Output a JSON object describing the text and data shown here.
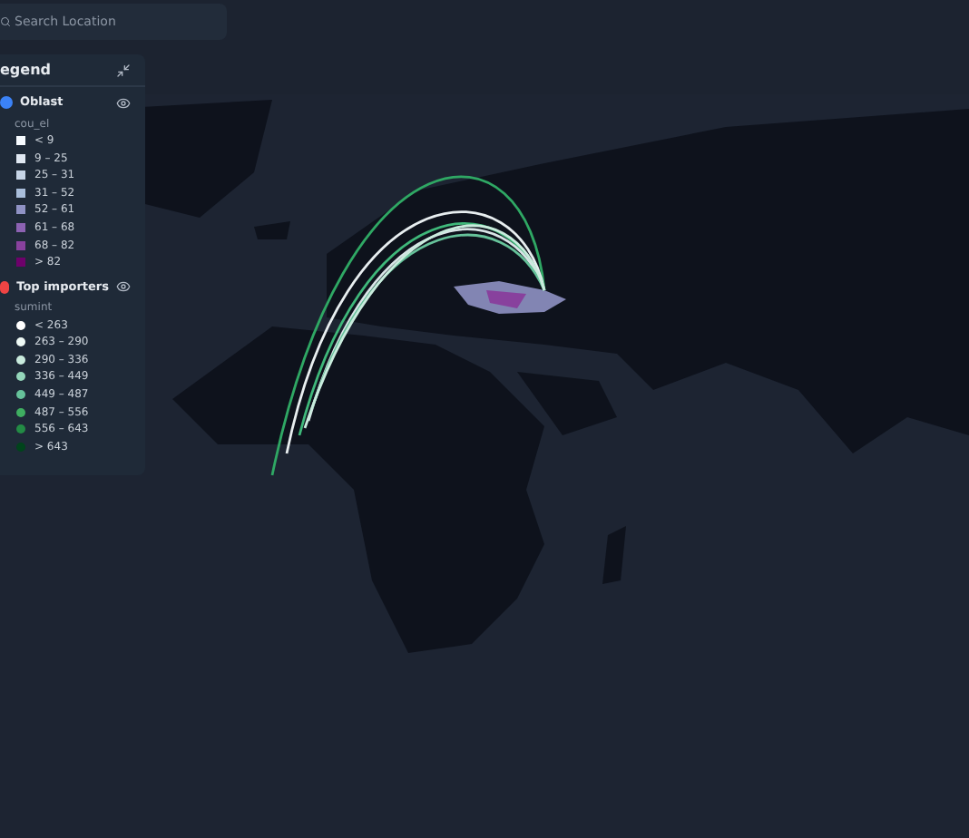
{
  "search": {
    "placeholder": "Search Location"
  },
  "legend": {
    "title": "egend",
    "layers": [
      {
        "name": "Oblast",
        "kind": "polygon",
        "visible": true,
        "field": "cou_el",
        "items": [
          {
            "label": "< 9",
            "color": "#f7fbff"
          },
          {
            "label": "9 – 25",
            "color": "#e0e8f2"
          },
          {
            "label": "25 – 31",
            "color": "#c6d4e6"
          },
          {
            "label": "31 – 52",
            "color": "#a9bedb"
          },
          {
            "label": "52 – 61",
            "color": "#8f92c4"
          },
          {
            "label": "61 – 68",
            "color": "#8c62b2"
          },
          {
            "label": "68 – 82",
            "color": "#88419d"
          },
          {
            "label": "> 82",
            "color": "#6e016b"
          }
        ]
      },
      {
        "name": "Top importers",
        "kind": "point",
        "visible": true,
        "field": "sumint",
        "items": [
          {
            "label": "< 263",
            "color": "#ffffff"
          },
          {
            "label": "263 – 290",
            "color": "#eef9f5"
          },
          {
            "label": "290 – 336",
            "color": "#c9ebdd"
          },
          {
            "label": "336 – 449",
            "color": "#94d6ba"
          },
          {
            "label": "449 – 487",
            "color": "#66c29a"
          },
          {
            "label": "487 – 556",
            "color": "#3fae61"
          },
          {
            "label": "556 – 643",
            "color": "#238b45"
          },
          {
            "label": "> 643",
            "color": "#00441b"
          }
        ]
      }
    ]
  }
}
